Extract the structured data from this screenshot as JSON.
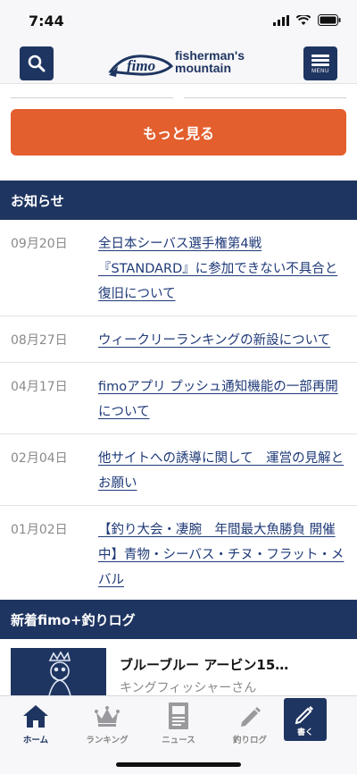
{
  "status": {
    "time": "7:44"
  },
  "header": {
    "logo_script": "fimo",
    "logo_line1": "fisherman's",
    "logo_line2": "mountain",
    "menu_label": "MENU"
  },
  "more_button": "もっと見る",
  "news": {
    "heading": "お知らせ",
    "items": [
      {
        "date": "09月20日",
        "title": "全日本シーバス選手権第4戦『STANDARD』に参加できない不具合と復旧について"
      },
      {
        "date": "08月27日",
        "title": "ウィークリーランキングの新設について"
      },
      {
        "date": "04月17日",
        "title": "fimoアプリ プッシュ通知機能の一部再開について"
      },
      {
        "date": "02月04日",
        "title": "他サイトへの誘導に関して　運営の見解とお願い"
      },
      {
        "date": "01月02日",
        "title": "【釣り大会・凄腕　年間最大魚勝負 開催中】青物・シーバス・チヌ・フラット・メバル"
      }
    ]
  },
  "fishing_log": {
    "heading": "新着fimo+釣りログ",
    "entry_title": "ブルーブルー アービン15…",
    "entry_user": "キングフィッシャーさん"
  },
  "tabs": [
    {
      "label": "ホーム",
      "icon": "home-icon",
      "active": true
    },
    {
      "label": "ランキング",
      "icon": "crown-icon",
      "active": false
    },
    {
      "label": "ニュース",
      "icon": "newspaper-icon",
      "active": false
    },
    {
      "label": "釣りログ",
      "icon": "pencil-icon",
      "active": false
    }
  ],
  "write_button": "書く",
  "colors": {
    "brand_navy": "#1f3561",
    "accent_orange": "#e35f2e",
    "link_blue": "#1f3a78"
  }
}
